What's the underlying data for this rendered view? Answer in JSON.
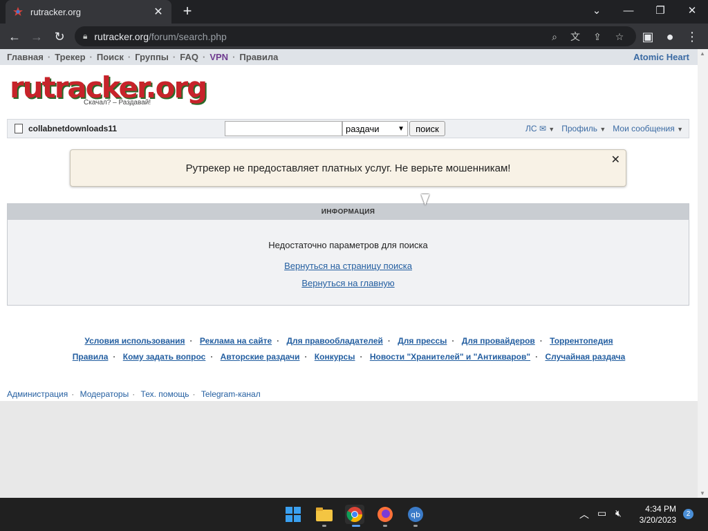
{
  "browser": {
    "tab_title": "rutracker.org",
    "url_host": "rutracker.org",
    "url_path": "/forum/search.php"
  },
  "site_nav": {
    "items": [
      "Главная",
      "Трекер",
      "Поиск",
      "Группы",
      "FAQ",
      "VPN",
      "Правила"
    ],
    "right_link": "Atomic Heart"
  },
  "logo": {
    "wordmark": "rutracker.org",
    "slogan": "Скачал? – Раздавай!"
  },
  "userbar": {
    "username": "collabnetdownloads11",
    "search_value": "",
    "search_scope": "раздачи",
    "search_button": "поиск",
    "menu": [
      "ЛС ✉",
      "Профиль",
      "Мои сообщения"
    ]
  },
  "alert": {
    "text": "Рутрекер не предоставляет платных услуг. Не верьте мошенникам!"
  },
  "info": {
    "header": "ИНФОРМАЦИЯ",
    "message": "Недостаточно параметров для поиска",
    "link_search": "Вернуться на страницу поиска",
    "link_home": "Вернуться на главную"
  },
  "footer": {
    "row1": [
      "Условия использования",
      "Реклама на сайте",
      "Для правообладателей",
      "Для прессы",
      "Для провайдеров",
      "Торрентопедия"
    ],
    "row2": [
      "Правила",
      "Кому задать вопрос",
      "Авторские раздачи",
      "Конкурсы",
      "Новости \"Хранителей\" и \"Антикваров\"",
      "Случайная раздача"
    ],
    "bottom": [
      "Администрация",
      "Модераторы",
      "Тех. помощь",
      "Telegram-канал"
    ]
  },
  "taskbar": {
    "time": "4:34 PM",
    "date": "3/20/2023",
    "notifications": "2"
  },
  "colors": {
    "link": "#235ea0",
    "vpn": "#6f3b8f",
    "alert_bg": "#f8f2e6"
  }
}
